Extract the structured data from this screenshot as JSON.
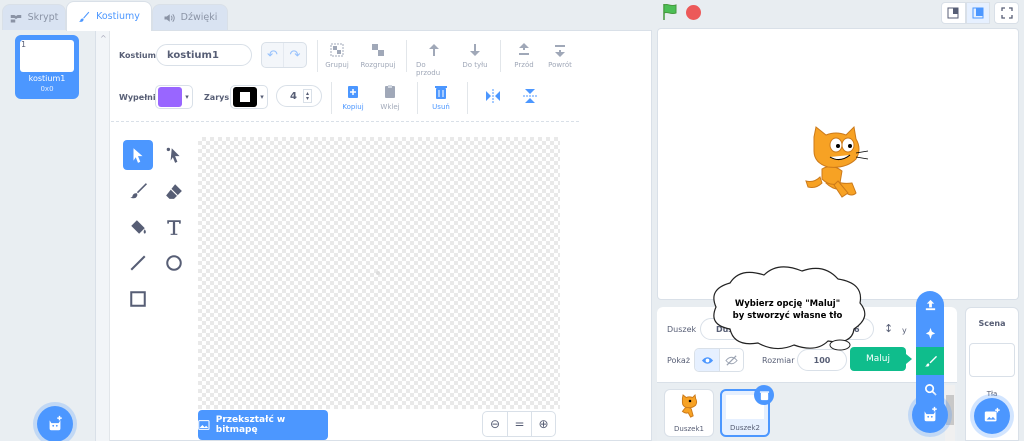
{
  "tabs": {
    "code": "Skrypt",
    "costumes": "Kostiumy",
    "sounds": "Dźwięki"
  },
  "costume_list": {
    "items": [
      {
        "number": "1",
        "name": "kostium1",
        "size": "0x0"
      }
    ]
  },
  "editor": {
    "costume_label": "Kostium",
    "costume_name": "kostium1",
    "group": "Grupuj",
    "ungroup": "Rozgrupuj",
    "forward": "Do przodu",
    "backward": "Do tyłu",
    "front": "Przód",
    "back": "Powrót",
    "fill_label": "Wypełnij",
    "outline_label": "Zarys",
    "outline_width": "4",
    "copy": "Kopiuj",
    "paste": "Wklej",
    "delete": "Usuń",
    "fill_color": "#9966ff",
    "outline_color": "#000000",
    "convert_button": "Przekształć w bitmapę",
    "zoom_reset": "="
  },
  "sprite_info": {
    "sprite_label": "Duszek",
    "sprite_name": "Duszek2",
    "x_value": "36",
    "y_label": "y",
    "show_label": "Pokaż",
    "size_label": "Rozmiar",
    "size_value": "100"
  },
  "sprites": [
    {
      "name": "Duszek1"
    },
    {
      "name": "Duszek2"
    }
  ],
  "stage_panel": {
    "title": "Scena",
    "backdrops_label": "Tła"
  },
  "paint_tooltip": "Maluj",
  "hint_bubble": {
    "line1": "Wybierz opcję \"Maluj\"",
    "line2": "by stworzyć własne tło"
  },
  "colors": {
    "accent": "#4c97ff",
    "paint": "#0fbd8c",
    "stop": "#ec5959",
    "flag": "#0fbd8c"
  }
}
